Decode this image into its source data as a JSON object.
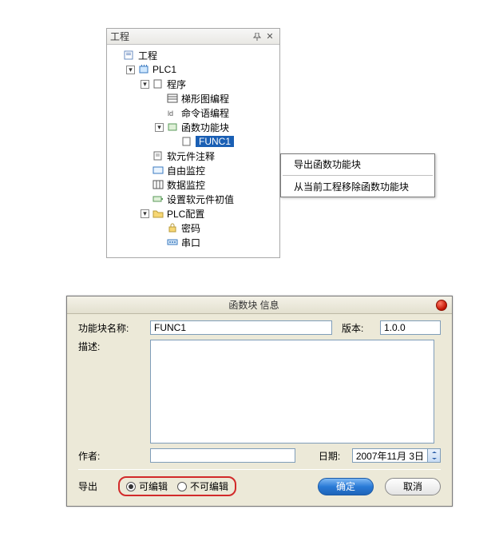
{
  "panel": {
    "title": "工程",
    "pin_icon": "pin-icon",
    "close_icon": "close-icon"
  },
  "tree": {
    "root": "工程",
    "plc": "PLC1",
    "program": "程序",
    "ladder": "梯形图编程",
    "mnemonic": "命令语编程",
    "funcblock": "函数功能块",
    "func1": "FUNC1",
    "softcomment": "软元件注释",
    "freemon": "自由监控",
    "datamon": "数据监控",
    "setdefault": "设置软元件初值",
    "plccfg": "PLC配置",
    "password": "密码",
    "serial": "串口"
  },
  "context_menu": {
    "export": "导出函数功能块",
    "remove": "从当前工程移除函数功能块"
  },
  "dialog": {
    "title": "函数块 信息",
    "name_label": "功能块名称:",
    "name_value": "FUNC1",
    "version_label": "版本:",
    "version_value": "1.0.0",
    "desc_label": "描述:",
    "desc_value": "",
    "author_label": "作者:",
    "author_value": "",
    "date_label": "日期:",
    "date_value": "2007年11月  3日",
    "export_label": "导出",
    "editable": "可编辑",
    "noneditable": "不可编辑",
    "ok": "确定",
    "cancel": "取消"
  }
}
